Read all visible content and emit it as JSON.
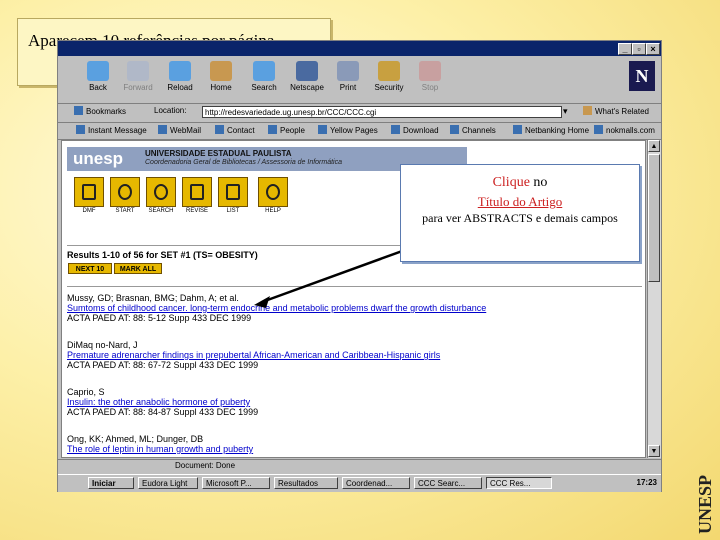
{
  "caption": "Aparecem 10 referências por página.",
  "toolbar": {
    "buttons": [
      "Back",
      "Forward",
      "Reload",
      "Home",
      "Search",
      "Netscape",
      "Print",
      "Security",
      "Stop"
    ],
    "disabled": [
      "Forward",
      "Stop"
    ]
  },
  "location": {
    "bookmarks_label": "Bookmarks",
    "location_label": "Location:",
    "url": "http://redesvariedade.ug.unesp.br/CCC/CCC.cgi",
    "related_label": "What's Related"
  },
  "personal_toolbar": [
    "Instant Message",
    "WebMail",
    "Contact",
    "People",
    "Yellow Pages",
    "Download",
    "Channels",
    "Netbanking Home",
    "nokmalls.com"
  ],
  "page": {
    "logo": "unesp",
    "university": "UNIVERSIDADE ESTADUAL PAULISTA",
    "subtitle": "Coordenadoria Geral de Bibliotecas / Assessoria de Informática",
    "nav_buttons": [
      "DMF",
      "START",
      "SEARCH",
      "REVISE",
      "LIST",
      "HELP"
    ],
    "results_heading": "Results 1-10 of 56 for SET #1 (TS= OBESITY)",
    "next_label": "NEXT 10",
    "mark_label": "MARK ALL",
    "records": [
      {
        "authors": "Mussy, GD; Brasnan, BMG; Dahm, A; et al.",
        "title": "Sumtoms of childhood cancer. long-term endocrine and metabolic problems dwarf the growth disturbance",
        "source": "ACTA PAED AT: 88: 5-12 Supp 433 DEC 1999"
      },
      {
        "authors": "DiMaq no-Nard, J",
        "title": "Premature adrenarcher findings in prepubertal African-American and Caribbean-Hispanic girls",
        "source": "ACTA PAED AT: 88: 67-72 Suppl 433 DEC 1999"
      },
      {
        "authors": "Caprio, S",
        "title": "Insulin: the other anabolic hormone of puberty",
        "source": "ACTA PAED AT: 88: 84-87 Suppl 433 DEC 1999"
      },
      {
        "authors": "Ong, KK; Ahmed, ML; Dunger, DB",
        "title": "The role of leptin in human growth and puberty",
        "source": ""
      }
    ]
  },
  "callout": {
    "clique": "Clique",
    "no": "no",
    "titulo": "Título do Artigo",
    "rest": "para ver ABSTRACTS e demais campos"
  },
  "status": "Document: Done",
  "taskbar": {
    "start": "Iniciar",
    "tasks": [
      "Eudora Light",
      "Microsoft P...",
      "Resultados",
      "Coordenad...",
      "CCC Searc...",
      "CCC Res..."
    ],
    "clock": "17:23"
  },
  "brand": "UNESP"
}
